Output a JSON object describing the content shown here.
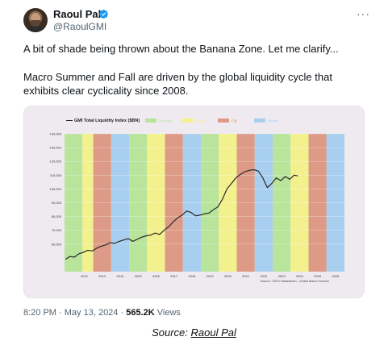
{
  "author": {
    "name": "Raoul Pal",
    "handle": "@RaoulGMI"
  },
  "icons": {
    "verified": "verified-badge-icon",
    "more": "more-options-icon"
  },
  "tweet": {
    "line1": "A bit of shade being thrown about the Banana Zone. Let me clarify...",
    "line2a": "Macro Summer and Fall are driven by the global liquidity cycle that",
    "line2b": "exhibits clear cyclicality since 2008."
  },
  "meta": {
    "time": "8:20 PM",
    "date": "May 13, 2024",
    "views_count": "565.2K",
    "views_label": "Views"
  },
  "source": {
    "prefix": "Source: ",
    "link": "Raoul Pal"
  },
  "colors": {
    "summer": "#b9e49b",
    "spring": "#f3f08e",
    "fall": "#dd9a86",
    "winter": "#a8cff0",
    "line": "#2a2a2a"
  },
  "chart_data": {
    "type": "line",
    "title": "GMI Total Liquidity Index ($BN)",
    "legend": [
      "Summer",
      "Spring",
      "Fall",
      "Winter"
    ],
    "legend_placement": "top",
    "source_note": "Source: LSEG Datastream - Global Macro Investor",
    "yticks": [
      "140,000",
      "130,000",
      "120,000",
      "110,000",
      "100,000",
      "90,000",
      "80,000",
      "70,000",
      "60,000"
    ],
    "xticks": [
      "2012",
      "2013",
      "2014",
      "2015",
      "2016",
      "2017",
      "2018",
      "2019",
      "2020",
      "2021",
      "2022",
      "2023",
      "2024",
      "2025",
      "2026"
    ],
    "ylim": [
      40000,
      140000
    ],
    "xlim": [
      2011.2,
      2026.8
    ],
    "bands": [
      [
        "summer",
        2011.2,
        2012.2
      ],
      [
        "spring",
        2012.2,
        2012.8
      ],
      [
        "fall",
        2012.8,
        2013.8
      ],
      [
        "winter",
        2013.8,
        2014.8
      ],
      [
        "summer",
        2014.8,
        2015.8
      ],
      [
        "spring",
        2015.8,
        2016.8
      ],
      [
        "fall",
        2016.8,
        2017.8
      ],
      [
        "winter",
        2017.8,
        2018.8
      ],
      [
        "summer",
        2018.8,
        2019.8
      ],
      [
        "spring",
        2019.8,
        2020.8
      ],
      [
        "fall",
        2020.8,
        2021.8
      ],
      [
        "winter",
        2021.8,
        2022.8
      ],
      [
        "summer",
        2022.8,
        2023.8
      ],
      [
        "spring",
        2023.8,
        2024.8
      ],
      [
        "fall",
        2024.8,
        2025.8
      ],
      [
        "winter",
        2025.8,
        2026.8
      ]
    ],
    "series": [
      {
        "x": [
          2011.25,
          2011.5,
          2011.75,
          2012.0,
          2012.25,
          2012.5,
          2012.75,
          2013.0,
          2013.25,
          2013.5,
          2013.75,
          2014.0,
          2014.25,
          2014.5,
          2014.75,
          2015.0,
          2015.25,
          2015.5,
          2015.75,
          2016.0,
          2016.25,
          2016.5,
          2016.75,
          2017.0,
          2017.25,
          2017.5,
          2017.75,
          2018.0,
          2018.25,
          2018.5,
          2018.75,
          2019.0,
          2019.25,
          2019.5,
          2019.75,
          2020.0,
          2020.25,
          2020.5,
          2020.75,
          2021.0,
          2021.25,
          2021.5,
          2021.75,
          2022.0,
          2022.25,
          2022.5,
          2022.75,
          2023.0,
          2023.25,
          2023.5,
          2023.75,
          2024.0,
          2024.2
        ],
        "y": [
          49000,
          51000,
          50500,
          53000,
          54000,
          55500,
          55000,
          57000,
          58500,
          59500,
          61000,
          60500,
          62000,
          63000,
          64000,
          62000,
          63500,
          65000,
          66000,
          66500,
          68000,
          67000,
          70000,
          72500,
          76000,
          79000,
          81000,
          84000,
          83000,
          80500,
          81000,
          82000,
          82500,
          85000,
          87000,
          92500,
          100000,
          104000,
          108000,
          110500,
          112500,
          113500,
          114000,
          113000,
          108000,
          101000,
          104000,
          108000,
          106000,
          109000,
          107000,
          110000,
          109500
        ]
      }
    ]
  }
}
